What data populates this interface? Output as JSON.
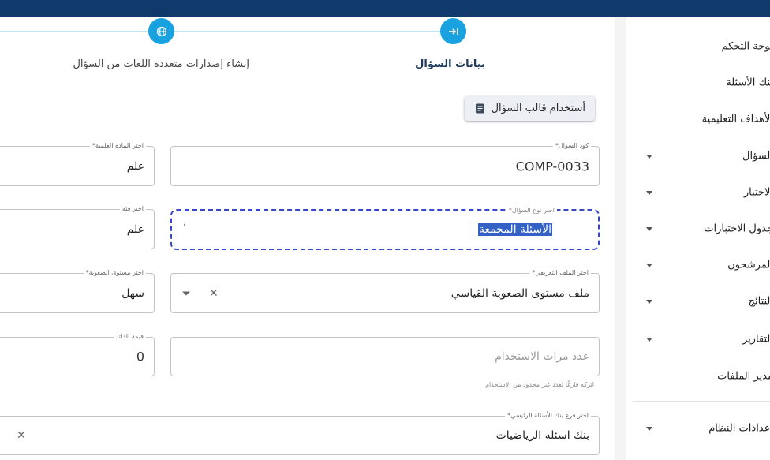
{
  "stepper": {
    "steps": [
      {
        "label": "بيانات السؤال",
        "icon": "arrow-right-to-line-icon",
        "active": true
      },
      {
        "label": "إنشاء إصدارات متعددة اللغات من السؤال",
        "icon": "globe-icon",
        "active": false
      }
    ]
  },
  "template_button": {
    "label": "أستخدام قالب السؤال",
    "icon": "document-icon"
  },
  "form": {
    "code": {
      "label": "كود السؤال*",
      "value": "COMP-0033"
    },
    "subject": {
      "label": "اختر المادة العلمية*",
      "value": "علم"
    },
    "type": {
      "label": "اختر نوع السؤال*",
      "value": "الأسئلة المجمعة"
    },
    "category": {
      "label": "اختر فئة",
      "value": "علم"
    },
    "profile": {
      "label": "اختر الملف التعريفي*",
      "value": "ملف مستوى الصعوبة القياسي"
    },
    "difficulty": {
      "label": "اختر مستوى الصعوبة*",
      "value": "سهل"
    },
    "usage": {
      "placeholder": "عدد مرات الاستخدام",
      "hint": "اتركه فارغًا لعدد غير محدود من الاستخدام"
    },
    "delta": {
      "label": "قيمة الدلتا",
      "value": "0"
    },
    "bank": {
      "label": "اختر فرع بنك الأسئلة الرئيسي*",
      "value": "بنك اسئله الرياضيات"
    }
  },
  "sidebar": {
    "items": [
      {
        "label": "لوحة التحكم",
        "has_submenu": false
      },
      {
        "label": "بنك الأسئلة",
        "has_submenu": false
      },
      {
        "label": "الأهداف التعليمية",
        "has_submenu": false
      },
      {
        "label": "السؤال",
        "has_submenu": true
      },
      {
        "label": "الاختبار",
        "has_submenu": true
      },
      {
        "label": "جدول الاختبارات",
        "has_submenu": true
      },
      {
        "label": "المرشحون",
        "has_submenu": true
      },
      {
        "label": "النتائج",
        "has_submenu": true
      },
      {
        "label": "التقارير",
        "has_submenu": true
      },
      {
        "label": "مدير الملفات",
        "has_submenu": false
      },
      {
        "label": "إعدادات النظام",
        "has_submenu": true
      }
    ]
  },
  "colors": {
    "topbar": "#0f3a6b",
    "accent": "#1aa1e0",
    "focus_border": "#3747c9",
    "selection": "#3561c7"
  }
}
